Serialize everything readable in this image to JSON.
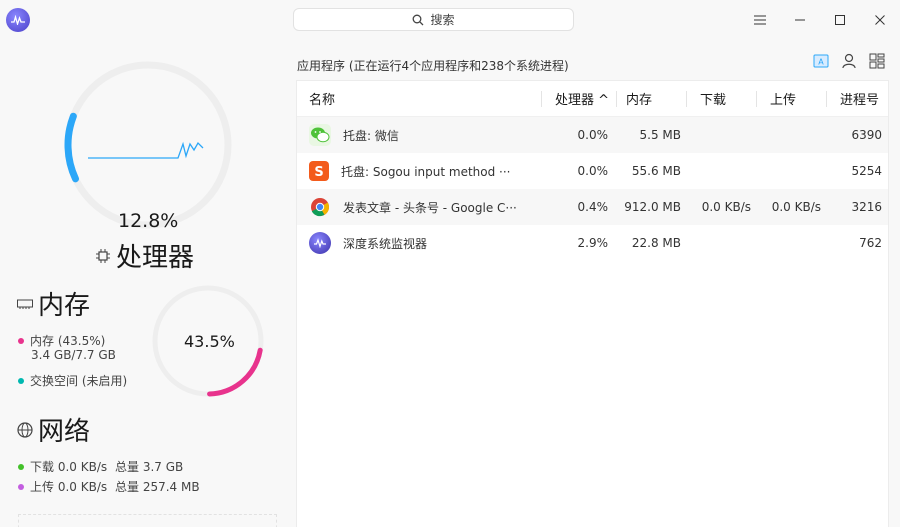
{
  "window": {
    "search_label": "搜索",
    "buttons": [
      "menu",
      "minimize",
      "maximize",
      "close"
    ]
  },
  "cpu": {
    "percent_text": "12.8%",
    "percent": 12.8,
    "title": "处理器",
    "accent": "#2ca7f8"
  },
  "memory": {
    "title": "内存",
    "percent_text": "43.5%",
    "percent": 43.5,
    "mem_label": "内存 (43.5%)",
    "mem_detail": "3.4 GB/7.7 GB",
    "swap_label": "交换空间 (未启用)",
    "mem_color": "#e8338d",
    "swap_color": "#00b8b0"
  },
  "network": {
    "title": "网络",
    "download_label": "下载 0.0 KB/s",
    "download_total": "总量 3.7 GB",
    "upload_label": "上传 0.0 KB/s",
    "upload_total": "总量 257.4 MB",
    "download_color": "#43c12a",
    "upload_color": "#c35ee0"
  },
  "apps": {
    "summary": "应用程序 (正在运行4个应用程序和238个系统进程)",
    "columns": [
      "名称",
      "处理器 ^",
      "内存",
      "下载",
      "上传",
      "进程号"
    ],
    "rows": [
      {
        "name": "托盘: 微信",
        "cpu": "0.0%",
        "mem": "5.5 MB",
        "down": "",
        "up": "",
        "pid": "6390",
        "icon": "wechat-icon"
      },
      {
        "name": "托盘: Sogou input method  ···",
        "cpu": "0.0%",
        "mem": "55.6 MB",
        "down": "",
        "up": "",
        "pid": "5254",
        "icon": "sogou-icon"
      },
      {
        "name": "发表文章 - 头条号 - Google C···",
        "cpu": "0.4%",
        "mem": "912.0 MB",
        "down": "0.0 KB/s",
        "up": "0.0 KB/s",
        "pid": "3216",
        "icon": "chrome-icon"
      },
      {
        "name": "深度系统监视器",
        "cpu": "2.9%",
        "mem": "22.8 MB",
        "down": "",
        "up": "",
        "pid": "762",
        "icon": "system-monitor-icon"
      }
    ]
  }
}
